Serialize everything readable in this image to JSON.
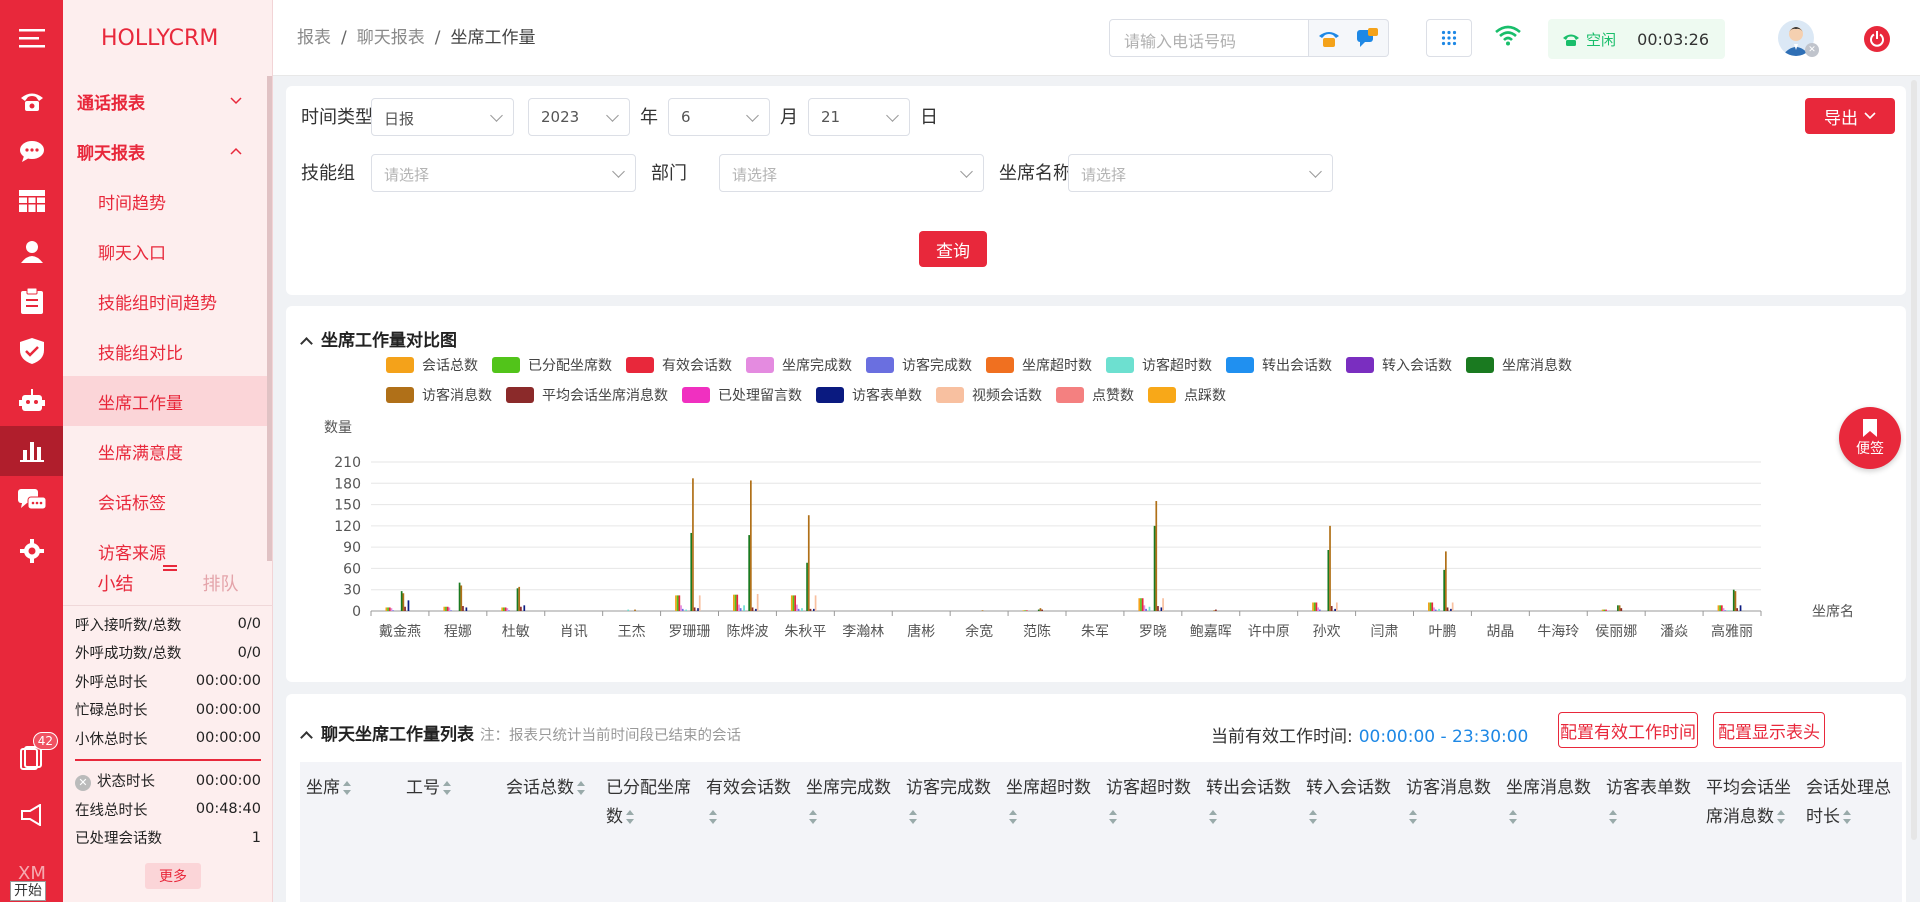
{
  "brand": "HOLLYCRM",
  "menu": {
    "groups": [
      {
        "label": "通话报表"
      },
      {
        "label": "聊天报表"
      }
    ],
    "items": [
      {
        "label": "时间趋势"
      },
      {
        "label": "聊天入口"
      },
      {
        "label": "技能组时间趋势"
      },
      {
        "label": "技能组对比"
      },
      {
        "label": "坐席工作量"
      },
      {
        "label": "坐席满意度"
      },
      {
        "label": "会话标签"
      },
      {
        "label": "访客来源"
      }
    ]
  },
  "summary": {
    "tabs": [
      "小结",
      "排队"
    ],
    "stats": [
      {
        "label": "呼入接听数/总数",
        "value": "0/0"
      },
      {
        "label": "外呼成功数/总数",
        "value": "0/0"
      },
      {
        "label": "外呼总时长",
        "value": "00:00:00"
      },
      {
        "label": "忙碌总时长",
        "value": "00:00:00"
      },
      {
        "label": "小休总时长",
        "value": "00:00:00"
      }
    ],
    "stats2": [
      {
        "label": "状态时长",
        "value": "00:00:00"
      },
      {
        "label": "在线总时长",
        "value": "00:48:40"
      },
      {
        "label": "已处理会话数",
        "value": "1"
      }
    ],
    "more": "更多"
  },
  "rail": {
    "badge": "42",
    "xm": "XM",
    "start": "开始"
  },
  "header": {
    "breadcrumb": [
      "报表",
      "聊天报表",
      "坐席工作量"
    ],
    "phone_placeholder": "请输入电话号码",
    "status": "空闲",
    "timer": "00:03:26"
  },
  "filter": {
    "time_type_label": "时间类型",
    "time_type": "日报",
    "year": "2023",
    "year_unit": "年",
    "month": "6",
    "month_unit": "月",
    "day": "21",
    "day_unit": "日",
    "skill_label": "技能组",
    "dept_label": "部门",
    "agent_label": "坐席名称",
    "placeholder": "请选择",
    "query": "查询",
    "export": "导出"
  },
  "chart_section": {
    "title": "坐席工作量对比图"
  },
  "chart_data": {
    "type": "bar",
    "ylabel": "数量",
    "xlabel": "坐席名",
    "ylim": [
      0,
      210
    ],
    "yticks": [
      0,
      30,
      60,
      90,
      120,
      150,
      180,
      210
    ],
    "legend_position": "top",
    "categories": [
      "戴金燕",
      "程娜",
      "杜敏",
      "肖讯",
      "王杰",
      "罗珊珊",
      "陈烨波",
      "朱秋平",
      "李瀚林",
      "唐彬",
      "余宽",
      "范陈",
      "朱军",
      "罗晓",
      "鲍嘉晖",
      "许中原",
      "孙欢",
      "闫肃",
      "叶鹏",
      "胡晶",
      "牛海玲",
      "侯丽娜",
      "潘焱",
      "高雅丽"
    ],
    "series": [
      {
        "name": "会话总数",
        "color": "#f4a21a",
        "values": [
          5,
          6,
          5,
          0,
          0,
          22,
          23,
          22,
          0,
          0,
          0,
          1,
          0,
          18,
          0,
          0,
          12,
          0,
          12,
          0,
          0,
          2,
          0,
          8
        ]
      },
      {
        "name": "已分配坐席数",
        "color": "#52c41a",
        "values": [
          5,
          6,
          5,
          0,
          0,
          22,
          23,
          22,
          0,
          0,
          0,
          1,
          0,
          18,
          0,
          0,
          12,
          0,
          12,
          0,
          0,
          2,
          0,
          8
        ]
      },
      {
        "name": "有效会话数",
        "color": "#e8283b",
        "values": [
          5,
          6,
          5,
          0,
          0,
          22,
          23,
          22,
          0,
          0,
          0,
          1,
          0,
          18,
          0,
          0,
          12,
          0,
          12,
          0,
          0,
          2,
          0,
          8
        ]
      },
      {
        "name": "坐席完成数",
        "color": "#e48be0",
        "values": [
          4,
          5,
          4,
          0,
          0,
          8,
          9,
          9,
          0,
          0,
          0,
          0,
          0,
          8,
          0,
          0,
          5,
          0,
          5,
          0,
          0,
          1,
          0,
          4
        ]
      },
      {
        "name": "访客完成数",
        "color": "#6a6fe0",
        "values": [
          1,
          1,
          1,
          0,
          0,
          3,
          4,
          3,
          0,
          0,
          0,
          0,
          0,
          3,
          0,
          0,
          2,
          0,
          2,
          0,
          0,
          0,
          0,
          1
        ]
      },
      {
        "name": "坐席超时数",
        "color": "#f07020",
        "values": [
          0,
          0,
          0,
          0,
          0,
          0,
          0,
          0,
          0,
          0,
          0,
          0,
          0,
          0,
          0,
          0,
          0,
          0,
          0,
          0,
          0,
          0,
          0,
          0
        ]
      },
      {
        "name": "访客超时数",
        "color": "#6de0d0",
        "values": [
          0,
          0,
          0,
          0,
          2,
          2,
          8,
          4,
          0,
          0,
          0,
          0,
          0,
          6,
          0,
          0,
          0,
          0,
          3,
          0,
          0,
          0,
          0,
          1
        ]
      },
      {
        "name": "转出会话数",
        "color": "#2090f0",
        "values": [
          0,
          0,
          0,
          0,
          0,
          0,
          0,
          0,
          0,
          0,
          0,
          0,
          0,
          0,
          0,
          0,
          0,
          0,
          0,
          0,
          0,
          0,
          0,
          0
        ]
      },
      {
        "name": "转入会话数",
        "color": "#7a2ec0",
        "values": [
          0,
          0,
          0,
          0,
          0,
          0,
          0,
          0,
          0,
          0,
          0,
          0,
          0,
          0,
          0,
          0,
          0,
          0,
          0,
          0,
          0,
          0,
          0,
          0
        ]
      },
      {
        "name": "坐席消息数",
        "color": "#1a7a20",
        "values": [
          28,
          40,
          32,
          0,
          0,
          110,
          107,
          68,
          0,
          0,
          0,
          2,
          0,
          120,
          0,
          0,
          86,
          0,
          58,
          0,
          0,
          8,
          0,
          30
        ]
      },
      {
        "name": "访客消息数",
        "color": "#b07018",
        "values": [
          25,
          36,
          34,
          0,
          2,
          187,
          184,
          135,
          0,
          0,
          1,
          4,
          0,
          155,
          1,
          0,
          120,
          0,
          84,
          0,
          0,
          8,
          0,
          28
        ]
      },
      {
        "name": "平均会话坐席消息数",
        "color": "#8b2a2a",
        "values": [
          6,
          7,
          6,
          0,
          0,
          5,
          5,
          3,
          0,
          0,
          0,
          2,
          0,
          7,
          2,
          0,
          7,
          0,
          5,
          0,
          0,
          4,
          0,
          4
        ]
      },
      {
        "name": "已处理留言数",
        "color": "#f030c0",
        "values": [
          0,
          0,
          0,
          0,
          0,
          0,
          0,
          0,
          0,
          0,
          0,
          0,
          0,
          0,
          0,
          0,
          0,
          0,
          0,
          0,
          0,
          0,
          0,
          0
        ]
      },
      {
        "name": "访客表单数",
        "color": "#0a1a80",
        "values": [
          15,
          5,
          8,
          0,
          0,
          4,
          3,
          3,
          0,
          0,
          0,
          0,
          0,
          5,
          0,
          0,
          3,
          0,
          3,
          0,
          0,
          0,
          0,
          8
        ]
      },
      {
        "name": "视频会话数",
        "color": "#f8c0a0",
        "values": [
          0,
          0,
          0,
          0,
          0,
          22,
          24,
          22,
          0,
          0,
          0,
          0,
          0,
          18,
          0,
          0,
          12,
          0,
          12,
          0,
          0,
          0,
          0,
          0
        ]
      },
      {
        "name": "点赞数",
        "color": "#f48080",
        "values": [
          0,
          0,
          0,
          0,
          0,
          0,
          0,
          0,
          0,
          0,
          0,
          0,
          0,
          0,
          0,
          0,
          0,
          0,
          0,
          0,
          0,
          0,
          0,
          0
        ]
      },
      {
        "name": "点踩数",
        "color": "#f8a818",
        "values": [
          0,
          0,
          0,
          0,
          0,
          0,
          0,
          0,
          0,
          0,
          0,
          0,
          0,
          0,
          0,
          0,
          0,
          0,
          0,
          0,
          0,
          0,
          0,
          0
        ]
      }
    ]
  },
  "table_section": {
    "title": "聊天坐席工作量列表",
    "note": "注：报表只统计当前时间段已结束的会话",
    "work_time_label": "当前有效工作时间:",
    "work_time": "00:00:00 - 23:30:00",
    "btn_config_time": "配置有效工作时间",
    "btn_config_header": "配置显示表头",
    "columns": [
      "坐席",
      "工号",
      "会话总数",
      "已分配坐席数",
      "有效会话数",
      "坐席完成数",
      "访客完成数",
      "坐席超时数",
      "访客超时数",
      "转出会话数",
      "转入会话数",
      "访客消息数",
      "坐席消息数",
      "访客表单数",
      "平均会话坐席消息数",
      "会话处理总时长"
    ]
  },
  "bookmark": {
    "label": "便签"
  }
}
